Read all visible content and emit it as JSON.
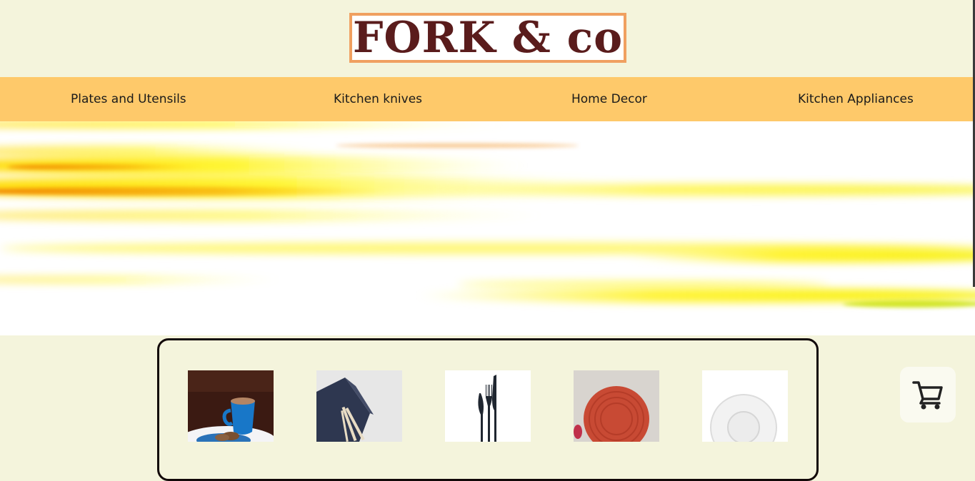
{
  "brand": {
    "logo_text": "FORK & co"
  },
  "nav": {
    "items": [
      {
        "label": "Plates and Utensils"
      },
      {
        "label": "Kitchen knives"
      },
      {
        "label": "Home Decor"
      },
      {
        "label": "Kitchen Appliances"
      }
    ]
  },
  "products": [
    {
      "icon": "coffee-cup-image"
    },
    {
      "icon": "napkin-cutlery-image"
    },
    {
      "icon": "cutlery-set-image"
    },
    {
      "icon": "red-plate-image"
    },
    {
      "icon": "white-saucer-image"
    }
  ],
  "cart": {
    "icon": "shopping-cart-icon"
  },
  "colors": {
    "background": "#f4f4dc",
    "nav": "#fec96a",
    "logo_text": "#5a1c1c",
    "logo_border": "#f0a060",
    "panel_border": "#120808"
  }
}
